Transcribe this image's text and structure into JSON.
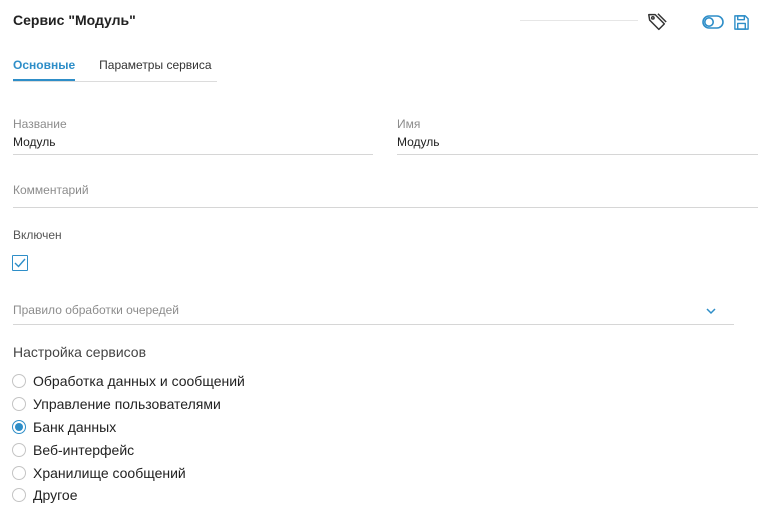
{
  "header": {
    "title": "Сервис \"Модуль\"",
    "icons": [
      "tag-icon",
      "toggle-icon",
      "save-icon"
    ],
    "accent_color": "#2e8ec8"
  },
  "tabs": [
    {
      "label": "Основные",
      "active": true
    },
    {
      "label": "Параметры сервиса",
      "active": false
    }
  ],
  "form": {
    "name_label": "Название",
    "name_value": "Модуль",
    "id_label": "Имя",
    "id_value": "Модуль",
    "comment_label": "Комментарий",
    "comment_value": "",
    "enabled_label": "Включен",
    "enabled_checked": true,
    "queue_rule_label": "Правило обработки очередей",
    "queue_rule_value": ""
  },
  "services": {
    "title": "Настройка сервисов",
    "options": [
      {
        "label": "Обработка данных и сообщений",
        "selected": false
      },
      {
        "label": "Управление пользователями",
        "selected": false
      },
      {
        "label": "Банк данных",
        "selected": true
      },
      {
        "label": "Веб-интерфейс",
        "selected": false
      },
      {
        "label": "Хранилище сообщений",
        "selected": false
      },
      {
        "label": "Другое",
        "selected": false
      }
    ]
  }
}
